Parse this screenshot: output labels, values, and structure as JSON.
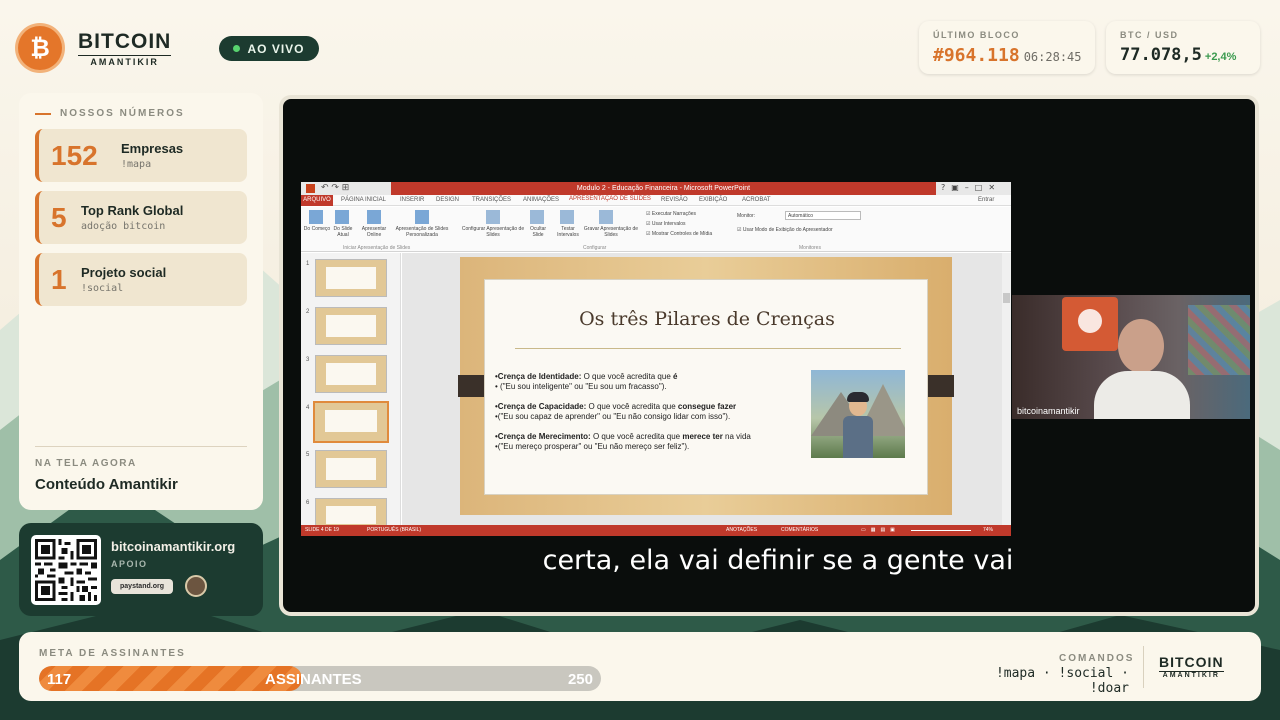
{
  "header": {
    "brand": "BITCOIN",
    "brand_sub": "AMANTIKIR",
    "coin_symbol": "₿",
    "live_label": "AO VIVO",
    "last_block": {
      "label": "ÚLTIMO BLOCO",
      "value": "#964.118",
      "time": "06:28:45"
    },
    "btc_usd": {
      "label": "BTC / USD",
      "value": "77.078,5",
      "change": "+2,4%"
    }
  },
  "stats": {
    "title": "NOSSOS NÚMEROS",
    "items": [
      {
        "number": "152",
        "name": "Empresas",
        "sub": "!mapa"
      },
      {
        "number": "5",
        "name": "Top Rank Global",
        "sub": "adoção bitcoin"
      },
      {
        "number": "1",
        "name": "Projeto social",
        "sub": "!social"
      }
    ],
    "now_label": "NA TELA AGORA",
    "now_value": "Conteúdo Amantikir"
  },
  "support": {
    "site": "bitcoinamantikir.org",
    "label": "APOIO",
    "paystand": "paystand.org"
  },
  "ppt": {
    "title_bar": "Modulo 2 - Educação Financeira - Microsoft PowerPoint",
    "tabs": [
      "ARQUIVO",
      "PÁGINA INICIAL",
      "INSERIR",
      "DESIGN",
      "TRANSIÇÕES",
      "ANIMAÇÕES",
      "APRESENTAÇÃO DE SLIDES",
      "REVISÃO",
      "EXIBIÇÃO",
      "ACROBAT"
    ],
    "signin": "Entrar",
    "ribbon_buttons": [
      "Do Começo",
      "Do Slide Atual",
      "Apresentar Online",
      "Apresentação de Slides Personalizada",
      "Configurar Apresentação de Slides",
      "Ocultar Slide",
      "Testar Intervalos",
      "Gravar Apresentação de Slides"
    ],
    "checks": [
      "Executar Narrações",
      "Usar Intervalos",
      "Mostrar Controles de Mídia"
    ],
    "monitor_label": "Monitor:",
    "monitor_value": "Automático",
    "presenter_check": "Usar Modo de Exibição do Apresentador",
    "groups": [
      "Iniciar Apresentação de Slides",
      "Configurar",
      "Monitores"
    ],
    "thumbs": [
      "1",
      "2",
      "3",
      "4",
      "5",
      "6"
    ],
    "slide_title": "Os três Pilares de Crenças",
    "bullets": [
      {
        "bold": "•Crença de Identidade:",
        "text": " O que você acredita que ",
        "bold2": "é",
        "text2": "",
        "line2": "• (\"Eu sou inteligente\" ou \"Eu sou um fracasso\")."
      },
      {
        "bold": "•Crença de Capacidade:",
        "text": " O que você acredita que ",
        "bold2": "consegue fazer",
        "text2": "",
        "line2": "•(\"Eu sou capaz de aprender\" ou \"Eu não consigo lidar com isso\")."
      },
      {
        "bold": "•Crença de Merecimento:",
        "text": " O que você acredita que ",
        "bold2": "merece ter",
        "text2": " na vida",
        "line2": "•(\"Eu mereço prosperar\" ou \"Eu não mereço ser feliz\")."
      }
    ],
    "status_left": "SLIDE 4 DE 19",
    "status_lang": "PORTUGUÊS (BRASIL)",
    "status_notes": "ANOTAÇÕES",
    "status_comments": "COMENTÁRIOS",
    "zoom": "74%"
  },
  "webcam": {
    "name": "bitcoinamantikir"
  },
  "subtitle": "certa, ela vai definir se a gente vai",
  "goal": {
    "label": "META DE ASSINANTES",
    "current": "117",
    "center": "ASSINANTES",
    "target": "250",
    "progress": 0.468
  },
  "commands": {
    "label": "COMANDOS",
    "text": "!mapa · !social · !doar",
    "brand": "BITCOIN",
    "brand_sub": "AMANTIKIR"
  },
  "colors": {
    "accent": "#d8742c",
    "dark": "#1c3b30",
    "live_dot": "#58d36f",
    "change": "#3a9a4e",
    "ppt_red": "#c0392b"
  }
}
